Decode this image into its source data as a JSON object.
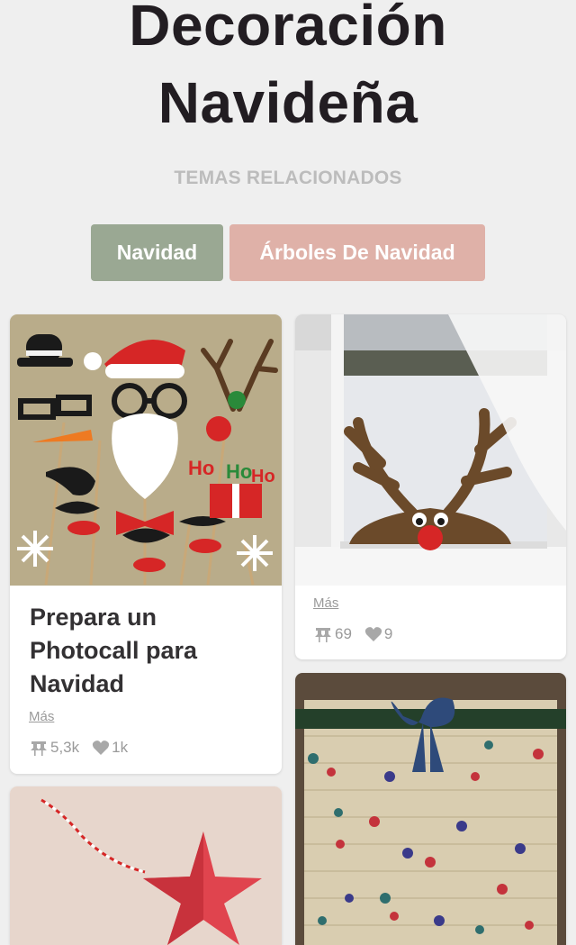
{
  "header": {
    "title_line1": "Decoración",
    "title_line2": "Navideña",
    "related_label": "TEMAS RELACIONADOS"
  },
  "related_topics": [
    {
      "label": "Navidad",
      "color": "#9aa893"
    },
    {
      "label": "Árboles De Navidad",
      "color": "#dfb1a8"
    }
  ],
  "pins": [
    {
      "title": "Prepara un Photocall para Navidad",
      "title_lines": [
        "Prepara un",
        "Photocall para",
        "Navidad"
      ],
      "more_label": "Más",
      "repins": "5,3k",
      "likes": "1k"
    },
    {
      "title": "",
      "more_label": "Más",
      "repins": "69",
      "likes": "9"
    }
  ],
  "icons": {
    "repin": "pushpin-icon",
    "like": "heart-icon"
  },
  "colors": {
    "background": "#efefef",
    "title": "#221d22",
    "muted": "#9a9a9a"
  }
}
